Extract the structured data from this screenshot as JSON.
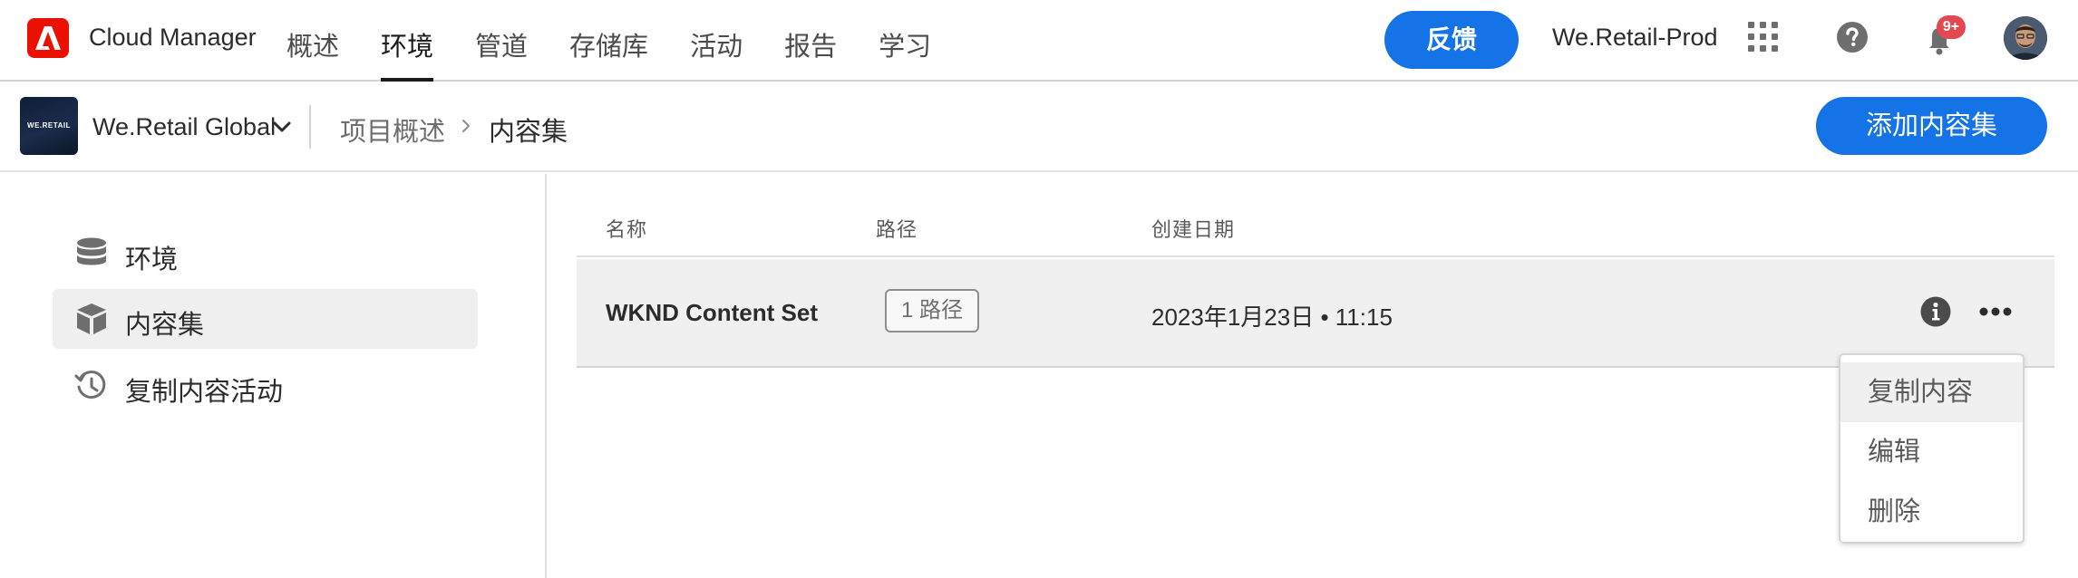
{
  "header": {
    "app_title": "Cloud Manager",
    "nav": [
      {
        "label": "概述",
        "active": false
      },
      {
        "label": "环境",
        "active": true
      },
      {
        "label": "管道",
        "active": false
      },
      {
        "label": "存储库",
        "active": false
      },
      {
        "label": "活动",
        "active": false
      },
      {
        "label": "报告",
        "active": false
      },
      {
        "label": "学习",
        "active": false
      }
    ],
    "feedback_label": "反馈",
    "org_name": "We.Retail-Prod",
    "notification_count": "9+",
    "icons": [
      "adobe-logo-icon",
      "apps-grid-icon",
      "help-icon",
      "bell-icon",
      "user-avatar"
    ]
  },
  "subheader": {
    "program_thumb_text": "WE.RETAIL",
    "program_name": "We.Retail Global",
    "breadcrumb": [
      "项目概述",
      "内容集"
    ],
    "add_button_label": "添加内容集"
  },
  "sidebar": {
    "items": [
      {
        "label": "环境",
        "icon": "database-icon",
        "active": false
      },
      {
        "label": "内容集",
        "icon": "box-icon",
        "active": true
      },
      {
        "label": "复制内容活动",
        "icon": "history-icon",
        "active": false
      }
    ]
  },
  "table": {
    "columns": [
      "名称",
      "路径",
      "创建日期"
    ],
    "rows": [
      {
        "name": "WKND Content Set",
        "paths": "1 路径",
        "created": "2023年1月23日 • 11:15"
      }
    ]
  },
  "menu": {
    "items": [
      "复制内容",
      "编辑",
      "删除"
    ]
  },
  "colors": {
    "accent": "#1473e6",
    "adobe_red": "#eb1000",
    "badge_red": "#e34850",
    "row_selected": "#f0f0f0"
  }
}
